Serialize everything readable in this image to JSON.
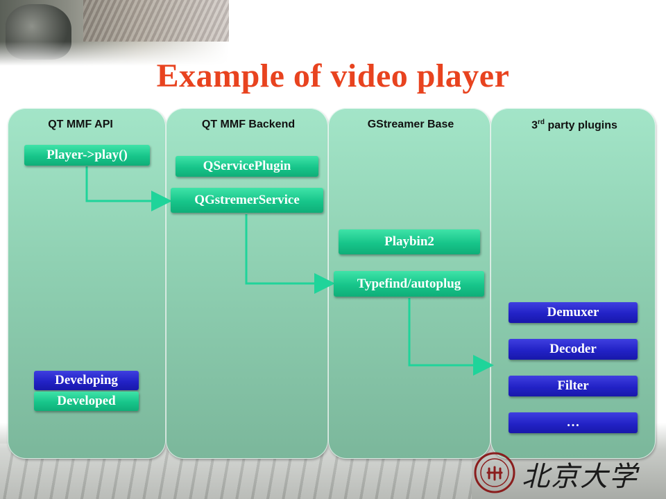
{
  "title": "Example of video player",
  "columns": [
    {
      "label": "QT MMF API"
    },
    {
      "label": "QT MMF Backend"
    },
    {
      "label": "GStreamer Base"
    },
    {
      "label_prefix": "3",
      "label_sup": "rd",
      "label_suffix": " party plugins"
    }
  ],
  "boxes": {
    "player_play": "Player->play()",
    "qserviceplugin": "QServicePlugin",
    "qgstremerservice": "QGstremerService",
    "playbin2": "Playbin2",
    "typefind_autoplug": "Typefind/autoplug",
    "demuxer": "Demuxer",
    "decoder": "Decoder",
    "filter": "Filter",
    "ellipsis": "…"
  },
  "legend": {
    "developing": "Developing",
    "developed": "Developed"
  },
  "branding": {
    "university_name": "北京大学"
  },
  "colors": {
    "title": "#e8431f",
    "developed": "#17c58a",
    "developing": "#2222c6",
    "column_fill": "#8fd0b2",
    "connector": "#1fd49a"
  }
}
